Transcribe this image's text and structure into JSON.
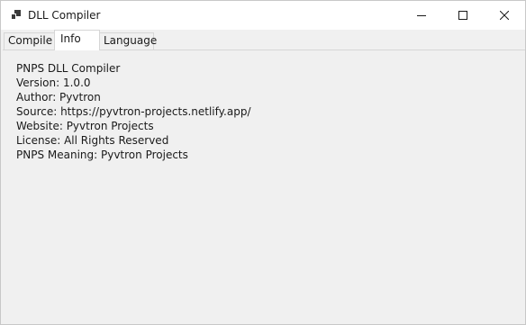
{
  "window": {
    "title": "DLL Compiler",
    "icons": {
      "app": "app-icon",
      "minimize": "minimize-icon",
      "maximize": "maximize-icon",
      "close": "close-icon"
    }
  },
  "tabs": [
    {
      "label": "Compile",
      "selected": false
    },
    {
      "label": "Info",
      "selected": true
    },
    {
      "label": "Language",
      "selected": false
    }
  ],
  "info": {
    "lines": [
      "PNPS DLL Compiler",
      "Version: 1.0.0",
      "Author: Pyvtron",
      "Source:  https://pyvtron-projects.netlify.app/",
      "Website: Pyvtron Projects",
      "License: All Rights Reserved",
      "PNPS Meaning: Pyvtron Projects"
    ]
  },
  "colors": {
    "titlebar": "#ffffff",
    "window_bg": "#f0f0f0",
    "text": "#1a1a1a"
  }
}
